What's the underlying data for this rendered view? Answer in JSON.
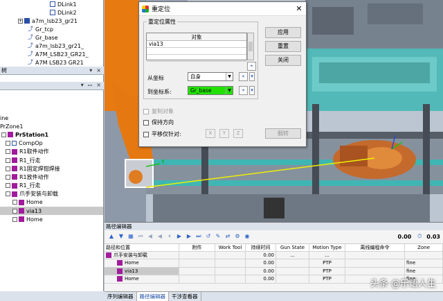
{
  "left_top_tree": [
    {
      "indent": 72,
      "icon": "link",
      "label": "DLink1"
    },
    {
      "indent": 72,
      "icon": "link",
      "label": "DLink2"
    },
    {
      "indent": 26,
      "icon": "blue",
      "label": "a7m_lsb23_gr21",
      "plus": true
    },
    {
      "indent": 40,
      "icon": "frame",
      "label": "Gr_tcp"
    },
    {
      "indent": 40,
      "icon": "frame",
      "label": "Gr_base"
    },
    {
      "indent": 40,
      "icon": "frame",
      "label": "a7m_lsb23_gr21_"
    },
    {
      "indent": 40,
      "icon": "frame",
      "label": "A7M_LSB23_GR21_"
    },
    {
      "indent": 40,
      "icon": "frame",
      "label": "A7M LSB23 GR21"
    }
  ],
  "panel_bar_1": {
    "label": "树",
    "ctrls": [
      "▾",
      "×"
    ]
  },
  "panel_bar_2": {
    "label": "",
    "ctrls": [
      "▾",
      "ꟷ",
      "×"
    ]
  },
  "left_bottom_tree": [
    {
      "indent": 0,
      "icon": "",
      "label": "ine"
    },
    {
      "indent": 0,
      "icon": "",
      "label": "PrZone1"
    },
    {
      "indent": 2,
      "icon": "mag",
      "label": "PrStation1",
      "bold": true
    },
    {
      "indent": 8,
      "icon": "sq",
      "label": "CompOp"
    },
    {
      "indent": 8,
      "icon": "mag",
      "label": "R1取件动作"
    },
    {
      "indent": 8,
      "icon": "mag",
      "label": "R1_行走"
    },
    {
      "indent": 8,
      "icon": "mag",
      "label": "R1固定焊钳焊接"
    },
    {
      "indent": 8,
      "icon": "mag",
      "label": "R1放件动作"
    },
    {
      "indent": 8,
      "icon": "mag",
      "label": "R1_行走"
    },
    {
      "indent": 8,
      "icon": "mag",
      "label": "爪手安装与卸载"
    },
    {
      "indent": 18,
      "icon": "mag",
      "label": "Home"
    },
    {
      "indent": 18,
      "icon": "mag",
      "label": "via13",
      "selected": true
    },
    {
      "indent": 18,
      "icon": "mag",
      "label": "Home"
    }
  ],
  "dialog": {
    "title": "重定位",
    "close": "✕",
    "group_label": "重定位属性",
    "obj_header": "对象",
    "obj_rows": [
      "via13",
      "",
      ""
    ],
    "from_label": "从坐标",
    "from_value": "自身",
    "to_label": "到坐标系:",
    "to_value": "Gr_base",
    "apply": "应用",
    "reset": "重置",
    "close_btn": "关闭",
    "copy_obj": "复制对象",
    "keep_orient": "保持方向",
    "translate_only": "平移仅针对:",
    "axes": [
      "X",
      "Y",
      "Z"
    ],
    "flip": "翻转"
  },
  "path_editor": {
    "title": "路径编辑器",
    "time1": "0.00",
    "time2": "0.03",
    "columns": [
      "路径和位置",
      "附件",
      "Work Tool",
      "持续时间",
      "Gun State",
      "Motion Type",
      "离线编程命令",
      "Zone"
    ],
    "rows": [
      {
        "name": "爪手安装与卸载",
        "attach": "",
        "tool": "",
        "dur": "0.00",
        "gun": "...",
        "motion": "...",
        "cmd": "",
        "zone": "",
        "indent": 2,
        "minus": true
      },
      {
        "name": "Home",
        "attach": "",
        "tool": "",
        "dur": "0.00",
        "gun": "",
        "motion": "PTP",
        "cmd": "",
        "zone": "fine",
        "indent": 18
      },
      {
        "name": "via13",
        "attach": "",
        "tool": "",
        "dur": "0.00",
        "gun": "",
        "motion": "PTP",
        "cmd": "",
        "zone": "fine",
        "indent": 18,
        "selected": true
      },
      {
        "name": "Home",
        "attach": "",
        "tool": "",
        "dur": "0.00",
        "gun": "",
        "motion": "PTP",
        "cmd": "",
        "zone": "fine",
        "indent": 18
      }
    ],
    "tabs": [
      "序列编辑器",
      "路径编辑器",
      "干涉查看器"
    ]
  },
  "watermark": "头条 @乐语人生",
  "colors": {
    "to_field": "#22e000",
    "robot_orange": "#e87a12",
    "teal": "#3fb6b3",
    "panel_bg": "#dbe2ec"
  }
}
